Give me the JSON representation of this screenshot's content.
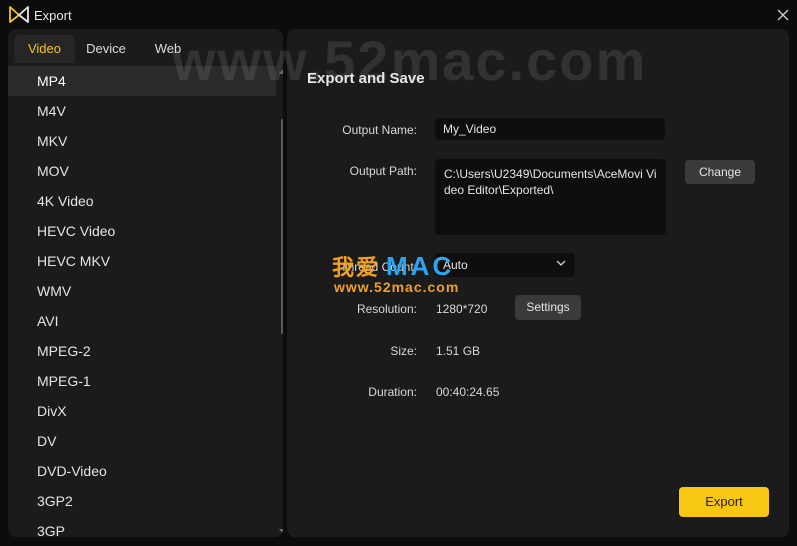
{
  "window": {
    "title": "Export"
  },
  "watermark": {
    "text": "www.52mac.com",
    "badge_cn": "我爱",
    "badge_mac": "MAC",
    "badge_url": "www.52mac.com"
  },
  "tabs": [
    {
      "label": "Video",
      "active": true
    },
    {
      "label": "Device",
      "active": false
    },
    {
      "label": "Web",
      "active": false
    }
  ],
  "formats": [
    "MP4",
    "M4V",
    "MKV",
    "MOV",
    "4K Video",
    "HEVC Video",
    "HEVC MKV",
    "WMV",
    "AVI",
    "MPEG-2",
    "MPEG-1",
    "DivX",
    "DV",
    "DVD-Video",
    "3GP2",
    "3GP"
  ],
  "selected_format": "MP4",
  "export_settings": {
    "title": "Export and Save",
    "output_name_label": "Output Name:",
    "output_name_value": "My_Video",
    "output_path_label": "Output Path:",
    "output_path_value": "C:\\Users\\U2349\\Documents\\AceMovi Video Editor\\Exported\\",
    "change_label": "Change",
    "thread_label": "Thread Count:",
    "thread_value": "Auto",
    "resolution_label": "Resolution:",
    "resolution_value": "1280*720",
    "settings_label": "Settings",
    "size_label": "Size:",
    "size_value": "1.51 GB",
    "duration_label": "Duration:",
    "duration_value": "00:40:24.65",
    "export_label": "Export"
  },
  "colors": {
    "accent": "#f8c713",
    "panel": "#1b1b1b",
    "background": "#0c0c0c",
    "field": "#0e0e0e"
  }
}
